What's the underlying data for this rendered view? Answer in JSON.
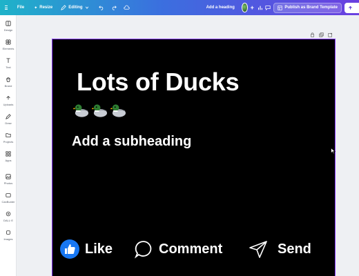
{
  "topbar": {
    "file_label": "File",
    "resize_label": "Resize",
    "editing_label": "Editing",
    "heading_label": "Add a heading",
    "publish_label": "Publish as Brand Template",
    "share_label": "Share"
  },
  "sidebar": {
    "items": [
      {
        "label": "Design",
        "icon": "design-icon"
      },
      {
        "label": "Elements",
        "icon": "elements-icon"
      },
      {
        "label": "Text",
        "icon": "text-icon"
      },
      {
        "label": "Brand",
        "icon": "brand-icon"
      },
      {
        "label": "Uploads",
        "icon": "uploads-icon"
      },
      {
        "label": "Draw",
        "icon": "draw-icon"
      },
      {
        "label": "Projects",
        "icon": "projects-icon"
      },
      {
        "label": "Apps",
        "icon": "apps-icon"
      },
      {
        "label": "Photos",
        "icon": "photos-icon"
      },
      {
        "label": "CanBunter",
        "icon": "canbunter-icon"
      },
      {
        "label": "DALL·E",
        "icon": "dalle-icon"
      },
      {
        "label": "Images",
        "icon": "images-icon"
      }
    ]
  },
  "design": {
    "title": "Lots of Ducks",
    "duck_count": 3,
    "subheading": "Add a subheading",
    "actions": {
      "like": "Like",
      "comment": "Comment",
      "send": "Send"
    }
  },
  "colors": {
    "accent": "#8b3dff",
    "canvas_bg": "#000000",
    "like_blue": "#1877f2"
  }
}
